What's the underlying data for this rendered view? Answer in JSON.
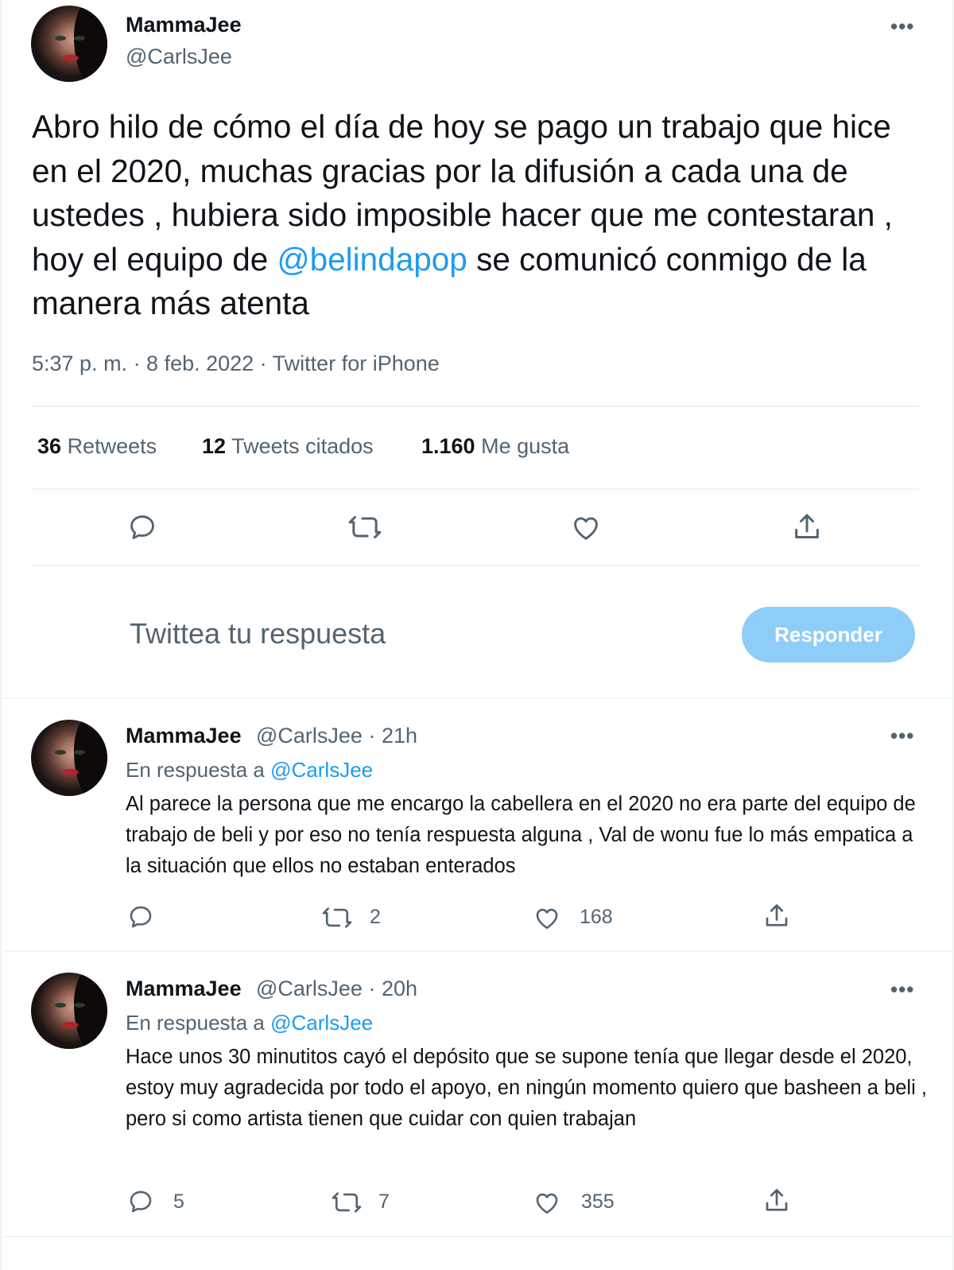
{
  "main_tweet": {
    "name": "MammaJee",
    "handle": "@CarlsJee",
    "more_label": "•••",
    "text_before": "Abro hilo de cómo el día de hoy se pago un trabajo que hice en el 2020, muchas gracias por la difusión a cada una de ustedes , hubiera sido imposible hacer que me contestaran , hoy el equipo de ",
    "mention": "@belindapop",
    "text_after": " se comunicó conmigo de la manera más atenta",
    "meta": "5:37 p. m. · 8 feb. 2022 · Twitter for iPhone",
    "stats": {
      "retweets_count": "36",
      "retweets_label": "Retweets",
      "quotes_count": "12",
      "quotes_label": "Tweets citados",
      "likes_count": "1.160",
      "likes_label": "Me gusta"
    },
    "actions": [
      "reply-icon",
      "retweet-icon",
      "like-icon",
      "share-icon"
    ]
  },
  "composer": {
    "placeholder": "Twittea tu respuesta",
    "button_label": "Responder",
    "button_color": "#8ecdf8"
  },
  "replies": [
    {
      "name": "MammaJee",
      "handle_time": "@CarlsJee · 21h",
      "reply_prefix": "En respuesta a ",
      "reply_mention": "@CarlsJee",
      "text": "Al parece la persona que me encargo la cabellera en el 2020 no era parte del equipo de trabajo de beli y por eso no tenía respuesta alguna , Val de wonu fue lo más empatica a la situación que ellos no estaban enterados",
      "replies_count": "",
      "retweets_count": "2",
      "likes_count": "168",
      "more_label": "•••"
    },
    {
      "name": "MammaJee",
      "handle_time": "@CarlsJee · 20h",
      "reply_prefix": "En respuesta a ",
      "reply_mention": "@CarlsJee",
      "text": "Hace unos 30 minutitos cayó el depósito que se supone tenía que llegar desde el 2020, estoy muy agradecida por todo el apoyo, en ningún momento quiero que basheen a beli , pero si como artista tienen que cuidar con quien trabajan",
      "replies_count": "5",
      "retweets_count": "7",
      "likes_count": "355",
      "more_label": "•••"
    }
  ],
  "colors": {
    "text": "#0f1419",
    "secondary": "#536471",
    "link": "#1d9bf0",
    "divider": "#eff3f4"
  }
}
